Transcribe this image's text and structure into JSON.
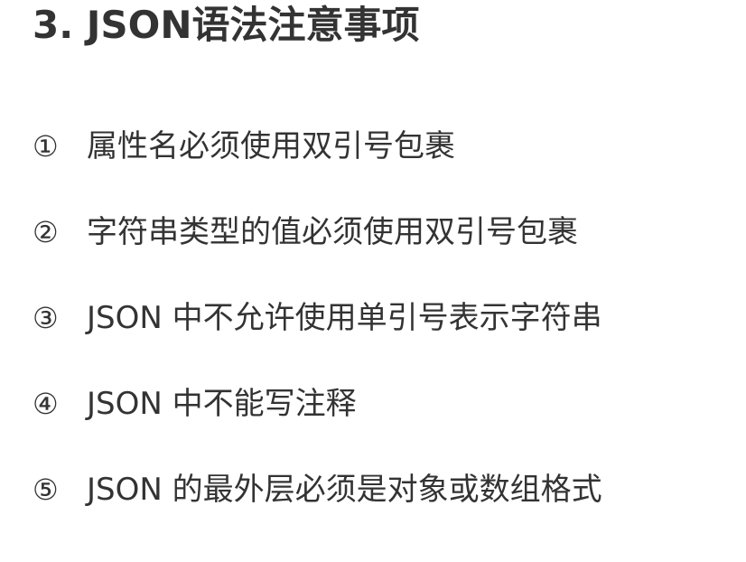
{
  "title": "3. JSON语法注意事项",
  "rules": [
    {
      "num": "①",
      "text": "属性名必须使用双引号包裹"
    },
    {
      "num": "②",
      "text": "字符串类型的值必须使用双引号包裹"
    },
    {
      "num": "③",
      "text": "JSON 中不允许使用单引号表示字符串"
    },
    {
      "num": "④",
      "text": "JSON 中不能写注释"
    },
    {
      "num": "⑤",
      "text": "JSON 的最外层必须是对象或数组格式"
    }
  ]
}
